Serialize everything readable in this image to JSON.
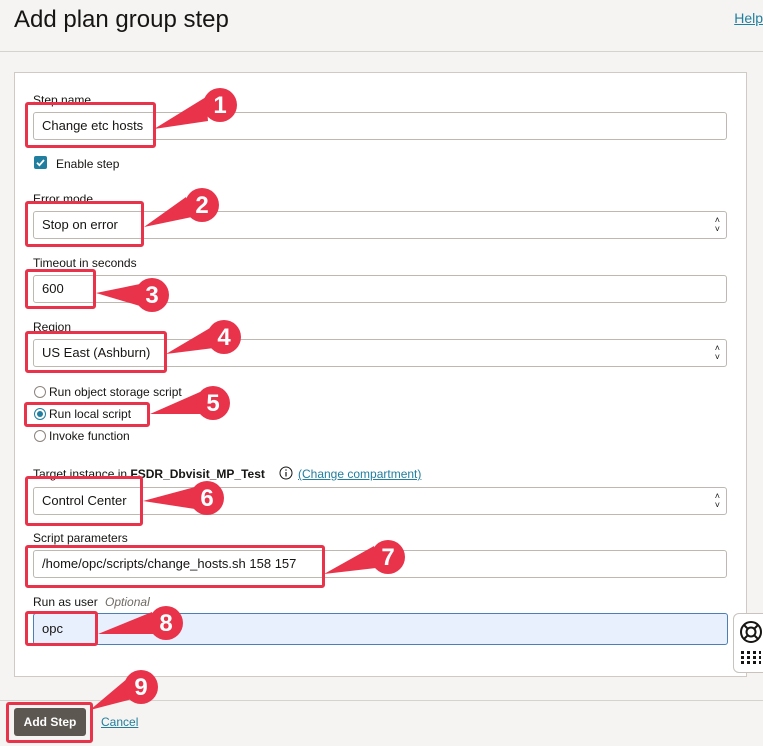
{
  "page": {
    "title": "Add plan group step",
    "help_label": "Help"
  },
  "form": {
    "step_name": {
      "label": "Step name",
      "value": "Change etc hosts"
    },
    "enable_step": {
      "label": "Enable step",
      "checked": true
    },
    "error_mode": {
      "label": "Error mode",
      "value": "Stop on error"
    },
    "timeout": {
      "label": "Timeout in seconds",
      "value": "600"
    },
    "region": {
      "label": "Region",
      "value": "US East (Ashburn)"
    },
    "script_type": {
      "options": [
        "Run object storage script",
        "Run local script",
        "Invoke function"
      ],
      "selected": "Run local script"
    },
    "target_instance": {
      "label_prefix": "Target instance in",
      "compartment": "FSDR_Dbvisit_MP_Test",
      "change_link": "(Change compartment)",
      "value": "Control Center"
    },
    "script_parameters": {
      "label": "Script parameters",
      "value": "/home/opc/scripts/change_hosts.sh 158 157"
    },
    "run_as_user": {
      "label": "Run as user",
      "optional": "Optional",
      "value": "opc"
    }
  },
  "footer": {
    "add_step": "Add Step",
    "cancel": "Cancel"
  },
  "callouts": [
    "1",
    "2",
    "3",
    "4",
    "5",
    "6",
    "7",
    "8",
    "9"
  ],
  "colors": {
    "accent": "#227e9e",
    "callout_red": "#e8334a",
    "primary_button": "#5c5751",
    "focused_input": "#e8f0fe"
  },
  "icons": [
    "checkbox-checked-icon",
    "info-icon",
    "select-arrows-icon",
    "help-ring-icon",
    "grid-dots-icon"
  ]
}
